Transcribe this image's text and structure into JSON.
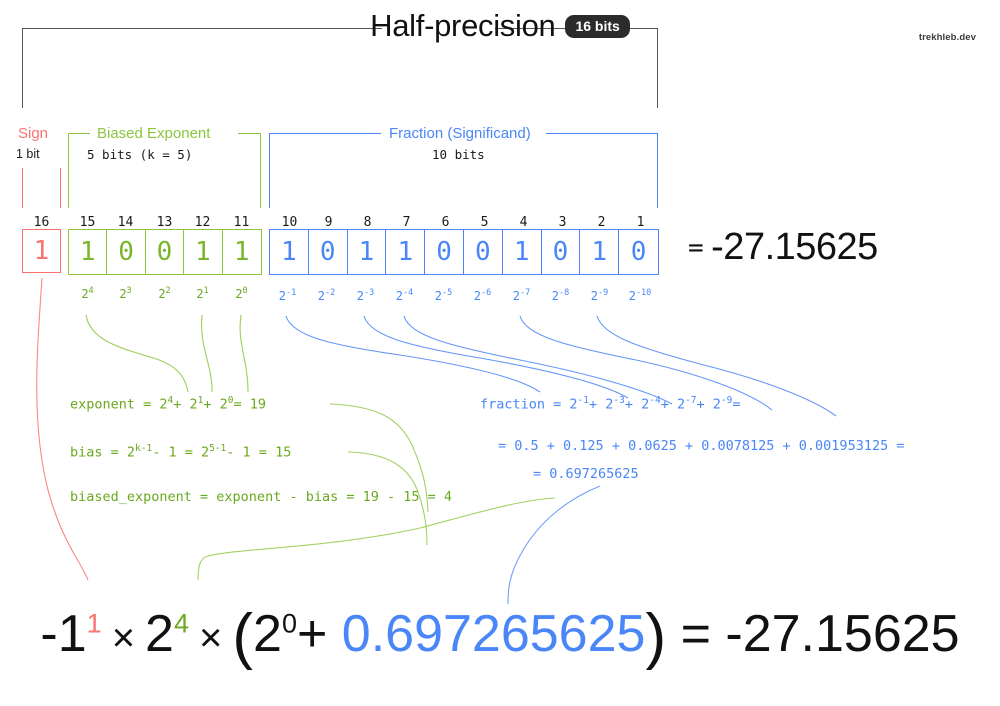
{
  "title": {
    "text": "Half-precision",
    "badge": "16 bits",
    "watermark": "trekhleb.dev"
  },
  "colors": {
    "sign": "#f8736f",
    "exponent": "#8cc63e",
    "exponent_text": "#6aa81f",
    "fraction": "#4a86f7",
    "ink": "#111111"
  },
  "groups": [
    {
      "name": "sign",
      "label": "Sign",
      "sublabel": "1 bit",
      "color": "#f8736f"
    },
    {
      "name": "exponent",
      "label": "Biased Exponent",
      "sublabel": "5 bits (k = 5)",
      "color": "#8cc63e"
    },
    {
      "name": "fraction",
      "label": "Fraction (Significand)",
      "sublabel": "10 bits",
      "color": "#4a86f7"
    }
  ],
  "bits": {
    "sign": {
      "indices": [
        "16"
      ],
      "values": [
        "1"
      ]
    },
    "exponent": {
      "indices": [
        "15",
        "14",
        "13",
        "12",
        "11"
      ],
      "values": [
        "1",
        "0",
        "0",
        "1",
        "1"
      ],
      "powers": [
        "2⁴",
        "2³",
        "2²",
        "2¹",
        "2⁰"
      ],
      "power_base": "2",
      "power_exps": [
        "4",
        "3",
        "2",
        "1",
        "0"
      ]
    },
    "fraction": {
      "indices": [
        "10",
        "9",
        "8",
        "7",
        "6",
        "5",
        "4",
        "3",
        "2",
        "1"
      ],
      "values": [
        "1",
        "0",
        "1",
        "1",
        "0",
        "0",
        "1",
        "0",
        "1",
        "0"
      ],
      "power_base": "2",
      "power_exps": [
        "-1",
        "-2",
        "-3",
        "-4",
        "-5",
        "-6",
        "-7",
        "-8",
        "-9",
        "-10"
      ]
    }
  },
  "result": {
    "equals": "=",
    "value": "-27.15625"
  },
  "exponent_math": {
    "line1_prefix": "exponent = 2",
    "line1": "exponent = 2⁴ + 2¹ + 2⁰ = 19",
    "line2": "bias = 2ᵏ⁻¹ - 1 = 2⁵⁻¹ - 1 = 15",
    "line3": "biased_exponent = exponent - bias = 19 - 15 = 4",
    "exponent_value": "19",
    "bias_value": "15",
    "biased_exponent_value": "4"
  },
  "fraction_math": {
    "line1": "fraction = 2⁻¹ + 2⁻³ + 2⁻⁴ + 2⁻⁷ + 2⁻⁹ =",
    "line2": "= 0.5 + 0.125 + 0.0625 + 0.0078125 + 0.001953125 =",
    "line3": "= 0.697265625",
    "terms": [
      "0.5",
      "0.125",
      "0.0625",
      "0.0078125",
      "0.001953125"
    ],
    "value": "0.697265625"
  },
  "bottom_formula": {
    "base": "-1",
    "sign_exp": "1",
    "times1": "×",
    "two": "2",
    "exp_exp": "4",
    "times2": "×",
    "open": "(",
    "inner_two": "2",
    "inner_exp": "0",
    "plus": "+",
    "fraction_value": "0.697265625",
    "close": ")",
    "equals": "=",
    "result": "-27.15625"
  }
}
